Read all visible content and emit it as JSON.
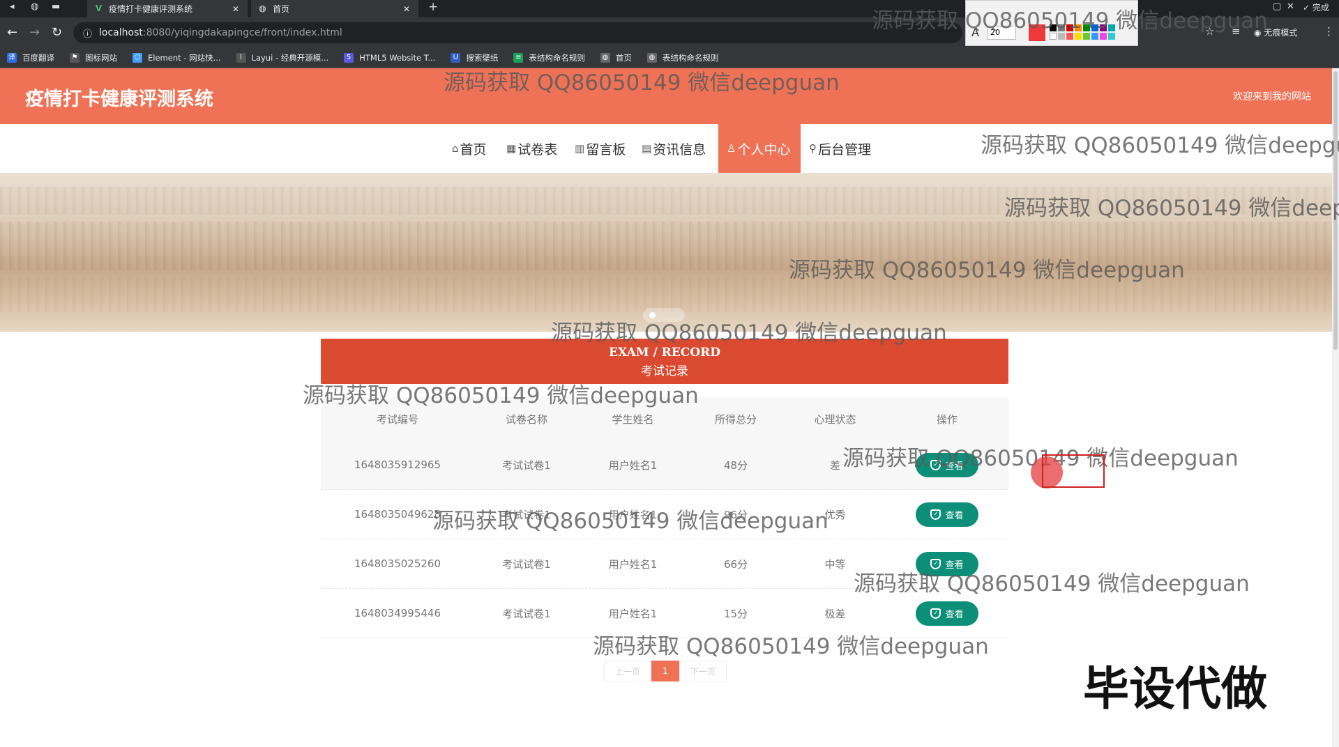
{
  "browser": {
    "tabs": [
      {
        "title": "疫情打卡健康评测系统",
        "favicon": "vue-icon",
        "active": false
      },
      {
        "title": "首页",
        "favicon": "globe-icon",
        "active": true
      }
    ],
    "url_host": "localhost",
    "url_path": ":8080/yiqingdakapingce/front/index.html",
    "incognito_label": "无痕模式",
    "annot_size": "20",
    "annot_done": "完成",
    "bookmarks": [
      {
        "label": "百度翻译",
        "color": "#2b6de5"
      },
      {
        "label": "图标网站",
        "color": "#555555"
      },
      {
        "label": "Element - 网站快...",
        "color": "#409eff"
      },
      {
        "label": "Layui - 经典开源模...",
        "color": "#555555"
      },
      {
        "label": "HTML5 Website T...",
        "color": "#5a5ae0"
      },
      {
        "label": "搜索壁纸",
        "color": "#3060c0"
      },
      {
        "label": "表结构命名规则",
        "color": "#1aa05a"
      },
      {
        "label": "首页",
        "color": "#666666"
      },
      {
        "label": "表结构命名规则",
        "color": "#666666"
      }
    ]
  },
  "header": {
    "title": "疫情打卡健康评测系统",
    "welcome": "欢迎来到我的网站"
  },
  "nav": [
    {
      "label": "首页",
      "icon": "home-icon"
    },
    {
      "label": "试卷表",
      "icon": "grid-icon"
    },
    {
      "label": "留言板",
      "icon": "board-icon"
    },
    {
      "label": "资讯信息",
      "icon": "news-icon"
    },
    {
      "label": "个人中心",
      "icon": "user-icon",
      "active": true
    },
    {
      "label": "后台管理",
      "icon": "link-icon"
    }
  ],
  "section": {
    "title_en": "EXAM / RECORD",
    "title_cn": "考试记录"
  },
  "table": {
    "headers": [
      "考试编号",
      "试卷名称",
      "学生姓名",
      "所得总分",
      "心理状态",
      "操作"
    ],
    "rows": [
      {
        "id": "1648035912965",
        "paper": "考试试卷1",
        "student": "用户姓名1",
        "score": "48分",
        "state": "差",
        "action": "查看"
      },
      {
        "id": "1648035049628",
        "paper": "考试试卷1",
        "student": "用户姓名1",
        "score": "96分",
        "state": "优秀",
        "action": "查看"
      },
      {
        "id": "1648035025260",
        "paper": "考试试卷1",
        "student": "用户姓名1",
        "score": "66分",
        "state": "中等",
        "action": "查看"
      },
      {
        "id": "1648034995446",
        "paper": "考试试卷1",
        "student": "用户姓名1",
        "score": "15分",
        "state": "极差",
        "action": "查看"
      }
    ]
  },
  "pager": {
    "prev": "上一页",
    "current": "1",
    "next": "下一页"
  },
  "watermark": "源码获取 QQ86050149 微信deepguan",
  "stamp": "毕设代做",
  "colors": {
    "accent": "#ef7256",
    "section": "#d94a31",
    "button": "#0c8e79"
  }
}
